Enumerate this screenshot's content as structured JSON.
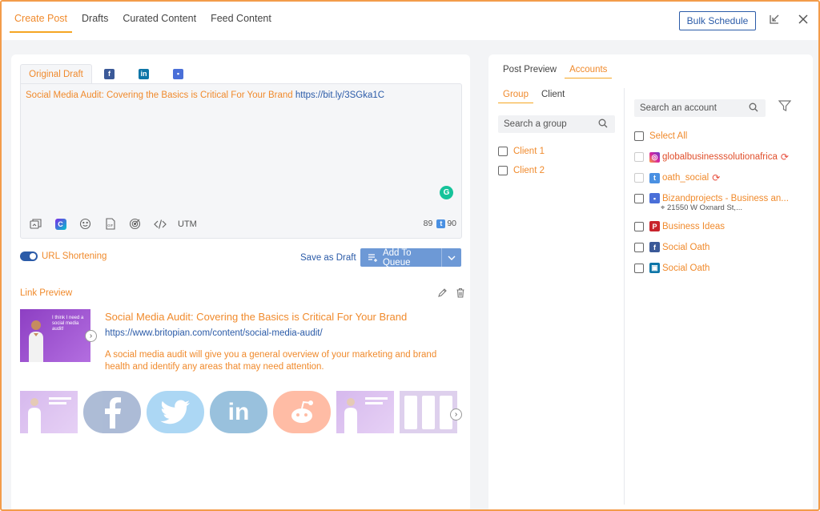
{
  "tabs": [
    {
      "label": "Create Post",
      "active": true
    },
    {
      "label": "Drafts"
    },
    {
      "label": "Curated Content"
    },
    {
      "label": "Feed Content"
    }
  ],
  "header": {
    "bulk_schedule": "Bulk Schedule",
    "icons": [
      "minimize-icon",
      "close-icon"
    ]
  },
  "editor": {
    "tab_original": "Original Draft",
    "network_tabs": [
      "facebook",
      "linkedin",
      "google-business"
    ],
    "text": "Social Media Audit: Covering the Basics is Critical For Your Brand ",
    "link": "https://bit.ly/3SGka1C",
    "tools": [
      "media-icon",
      "canva-icon",
      "emoji-icon",
      "gif-icon",
      "target-icon",
      "code-icon"
    ],
    "utm": "UTM",
    "char_count": "89",
    "twitter_count": "90"
  },
  "actions": {
    "url_shortening": "URL Shortening",
    "save_draft": "Save as Draft",
    "add_to_queue": "Add To Queue"
  },
  "link_preview": {
    "title": "Link Preview",
    "headline": "Social Media Audit: Covering the Basics is Critical For Your Brand",
    "url": "https://www.britopian.com/content/social-media-audit/",
    "description": "A social media audit will give you a general overview of your marketing and brand health and identify any areas that may need attention.",
    "thumb_text": "I think I need a social media audit!"
  },
  "right": {
    "tabs": [
      "Post Preview",
      "Accounts"
    ],
    "group_tabs": [
      "Group",
      "Client"
    ],
    "group_search_placeholder": "Search a group",
    "groups": [
      "Client 1",
      "Client 2"
    ],
    "account_search_placeholder": "Search an account",
    "select_all": "Select All",
    "accounts": [
      {
        "name": "globalbusinesssolutionafrica",
        "network": "instagram",
        "color": "#d6249f"
      },
      {
        "name": "oath_social",
        "network": "twitter",
        "color": "#4a90e2"
      },
      {
        "name": "Bizandprojects - Business an...",
        "network": "google-business",
        "color": "#4a6fd8",
        "address": "21550 W Oxnard St,..."
      },
      {
        "name": "Business Ideas",
        "network": "pinterest",
        "color": "#c8232c"
      },
      {
        "name": "Social Oath",
        "network": "facebook",
        "color": "#3b5998"
      },
      {
        "name": "Social Oath",
        "network": "linkedin-page",
        "color": "#0e76a8"
      }
    ]
  },
  "colors": {
    "accent": "#f08a2c",
    "primary": "#2b5ba8",
    "queue": "#6d99d6",
    "frame": "#f39c4a"
  }
}
